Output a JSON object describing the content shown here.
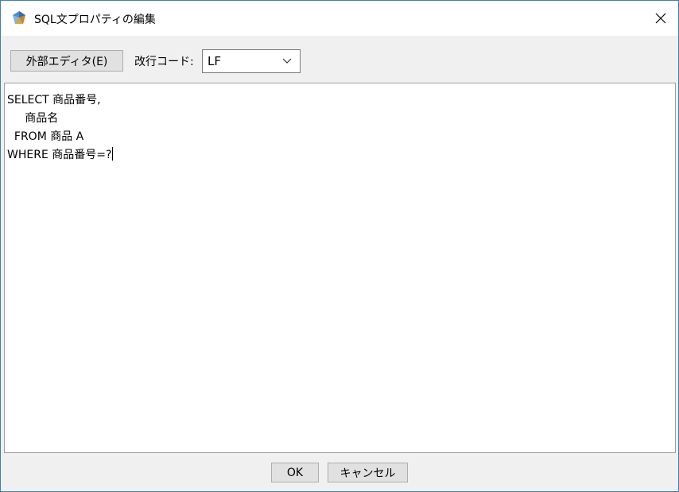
{
  "window": {
    "title": "SQL文プロパティの編集",
    "icon": "app-gem-icon",
    "close_icon": "close-icon"
  },
  "toolbar": {
    "external_editor_label": "外部エディタ(E)",
    "line_ending_label": "改行コード:",
    "line_ending_value": "LF"
  },
  "editor": {
    "lines": [
      "SELECT 商品番号,",
      "     商品名",
      "  FROM 商品 A",
      "WHERE 商品番号=?"
    ]
  },
  "footer": {
    "ok_label": "OK",
    "cancel_label": "キャンセル"
  },
  "colors": {
    "window_border": "#3c7fb1",
    "dialog_bg": "#f0f0f0",
    "button_bg": "#e1e1e1"
  }
}
